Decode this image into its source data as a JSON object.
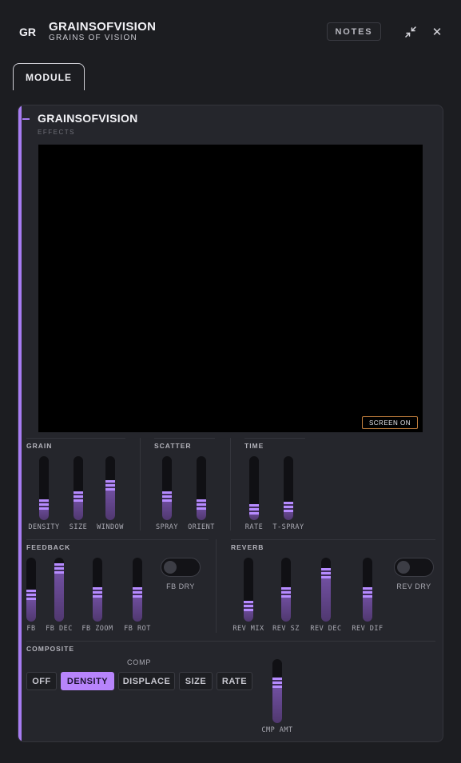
{
  "header": {
    "badge": "GR",
    "title": "GRAINSOFVISION",
    "subtitle": "GRAINS OF VISION",
    "notes_label": "NOTES",
    "minimize_icon": "collapse-arrows-icon",
    "close_icon": "close-icon",
    "close_glyph": "✕"
  },
  "tabs": [
    {
      "label": "MODULE",
      "active": true
    }
  ],
  "module": {
    "title": "GRAINSOFVISION",
    "category": "EFFECTS",
    "screen_button": "SCREEN ON",
    "accent_color": "#a77cf2"
  },
  "groups": {
    "grain": {
      "label": "GRAIN",
      "sliders": [
        {
          "label": "DENSITY",
          "value": 0.2
        },
        {
          "label": "SIZE",
          "value": 0.35
        },
        {
          "label": "WINDOW",
          "value": 0.55
        }
      ]
    },
    "scatter": {
      "label": "SCATTER",
      "sliders": [
        {
          "label": "SPRAY",
          "value": 0.35
        },
        {
          "label": "ORIENT",
          "value": 0.2
        }
      ]
    },
    "time": {
      "label": "TIME",
      "sliders": [
        {
          "label": "RATE",
          "value": 0.1
        },
        {
          "label": "T-SPRAY",
          "value": 0.15
        }
      ]
    },
    "feedback": {
      "label": "FEEDBACK",
      "sliders": [
        {
          "label": "FB",
          "value": 0.4
        },
        {
          "label": "FB DEC",
          "value": 0.9
        },
        {
          "label": "FB ZOOM",
          "value": 0.45
        },
        {
          "label": "FB ROT",
          "value": 0.45
        }
      ],
      "toggle": {
        "label": "FB DRY",
        "on": false
      }
    },
    "reverb": {
      "label": "REVERB",
      "sliders": [
        {
          "label": "REV MIX",
          "value": 0.2
        },
        {
          "label": "REV SZ",
          "value": 0.45
        },
        {
          "label": "REV DEC",
          "value": 0.8
        },
        {
          "label": "REV DIF",
          "value": 0.45
        }
      ],
      "toggle": {
        "label": "REV DRY",
        "on": false
      }
    },
    "composite": {
      "label": "COMPOSITE",
      "comp_label": "COMP",
      "options": [
        "OFF",
        "DENSITY",
        "DISPLACE",
        "SIZE",
        "RATE"
      ],
      "selected": "DENSITY",
      "slider": {
        "label": "CMP AMT",
        "value": 0.65
      }
    }
  },
  "colors": {
    "accent": "#b784fb",
    "background": "#1c1d21",
    "panel": "#25262c",
    "screen_button_border": "#c7823e"
  }
}
